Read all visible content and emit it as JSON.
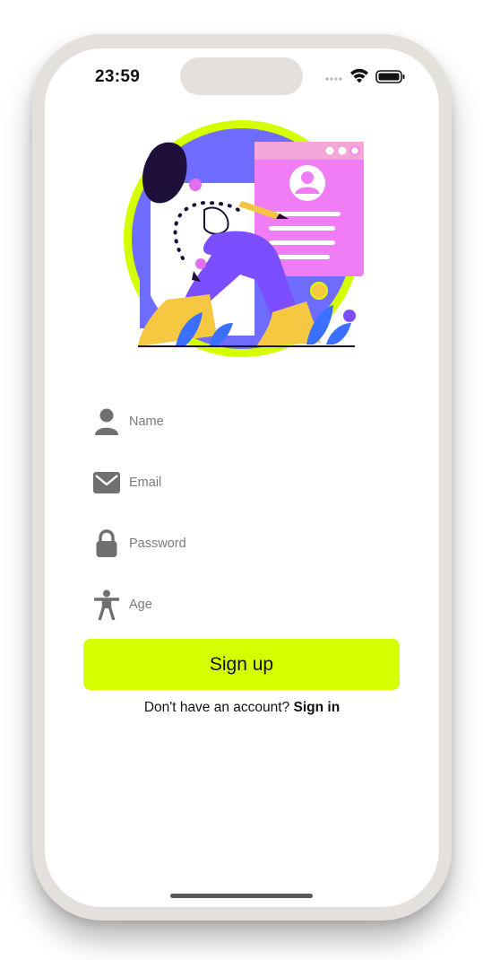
{
  "status_bar": {
    "time": "23:59",
    "signal_icon": "cellular-dots-icon",
    "wifi_icon": "wifi-icon",
    "battery_icon": "battery-icon"
  },
  "form": {
    "fields": [
      {
        "icon": "person-icon",
        "placeholder": "Name",
        "value": ""
      },
      {
        "icon": "envelope-icon",
        "placeholder": "Email",
        "value": ""
      },
      {
        "icon": "lock-icon",
        "placeholder": "Password",
        "value": ""
      },
      {
        "icon": "accessibility-icon",
        "placeholder": "Age",
        "value": ""
      }
    ],
    "submit_label": "Sign up",
    "footer_text": "Don't have an account?",
    "footer_link": "Sign in"
  },
  "colors": {
    "accent": "#d4ff00",
    "icon_gray": "#707070",
    "figure_purple": "#7b4fff",
    "card_pink": "#f07cf6",
    "frame": "#e4e0db"
  }
}
